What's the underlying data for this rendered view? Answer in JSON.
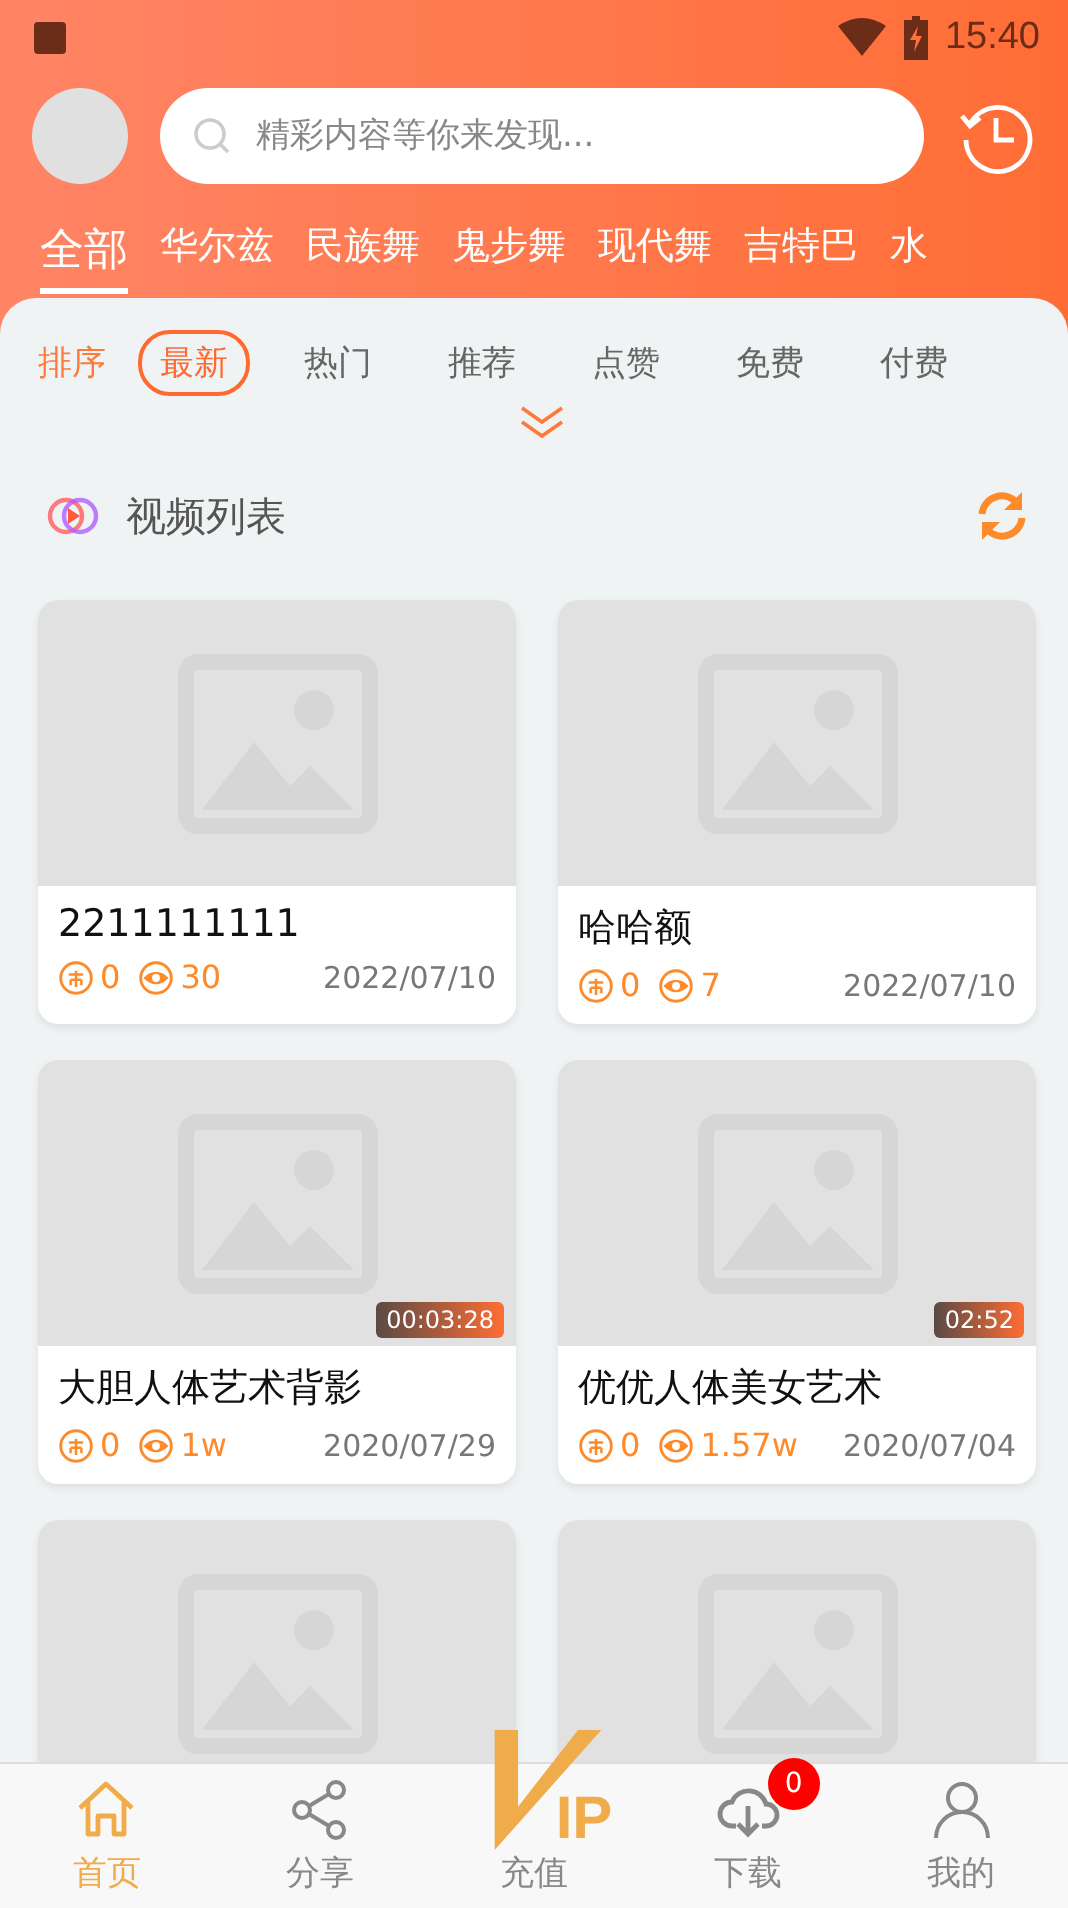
{
  "status_bar": {
    "time": "15:40"
  },
  "search": {
    "placeholder": "精彩内容等你来发现..."
  },
  "categories": [
    {
      "label": "全部",
      "selected": true
    },
    {
      "label": "华尔兹",
      "selected": false
    },
    {
      "label": "民族舞",
      "selected": false
    },
    {
      "label": "鬼步舞",
      "selected": false
    },
    {
      "label": "现代舞",
      "selected": false
    },
    {
      "label": "吉特巴",
      "selected": false
    },
    {
      "label": "水",
      "selected": false
    }
  ],
  "sort": {
    "label": "排序",
    "options": [
      {
        "label": "最新",
        "selected": true
      },
      {
        "label": "热门",
        "selected": false
      },
      {
        "label": "推荐",
        "selected": false
      },
      {
        "label": "点赞",
        "selected": false
      },
      {
        "label": "免费",
        "selected": false
      },
      {
        "label": "付费",
        "selected": false
      }
    ]
  },
  "section": {
    "title": "视频列表"
  },
  "videos": [
    {
      "kind": "video",
      "title": "2211111111",
      "coins": "0",
      "views": "30",
      "date": "2022/07/10"
    },
    {
      "kind": "video",
      "title": "哈哈额",
      "coins": "0",
      "views": "7",
      "date": "2022/07/10"
    },
    {
      "kind": "video",
      "title": "大胆人体艺术背影",
      "coins": "0",
      "views": "1w",
      "date": "2020/07/29",
      "duration": "00:03:28"
    },
    {
      "kind": "video",
      "title": "优优人体美女艺术",
      "coins": "0",
      "views": "1.57w",
      "date": "2020/07/04",
      "duration": "02:52"
    },
    {
      "kind": "cover"
    },
    {
      "kind": "cover"
    }
  ],
  "bottom_nav": [
    {
      "kind": "home",
      "label": "首页",
      "selected": true
    },
    {
      "kind": "share",
      "label": "分享",
      "selected": false
    },
    {
      "kind": "vip",
      "label": "充值",
      "logo": "IP",
      "selected": false
    },
    {
      "kind": "download",
      "label": "下载",
      "badge": "0",
      "selected": false
    },
    {
      "kind": "me",
      "label": "我的",
      "selected": false
    }
  ]
}
